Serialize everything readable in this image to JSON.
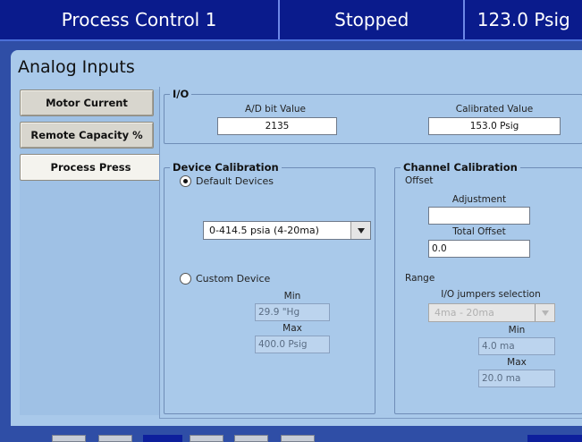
{
  "header": {
    "title": "Process Control 1",
    "status": "Stopped",
    "pressure": "123.0 Psig"
  },
  "panel": {
    "title": "Analog Inputs"
  },
  "tabs": [
    {
      "label": "Motor Current",
      "active": false
    },
    {
      "label": "Remote Capacity %",
      "active": false
    },
    {
      "label": "Process Press",
      "active": true
    }
  ],
  "io": {
    "legend": "I/O",
    "ad_bit_label": "A/D bit Value",
    "ad_bit_value": "2135",
    "calibrated_label": "Calibrated Value",
    "calibrated_value": "153.0 Psig"
  },
  "device_calibration": {
    "legend": "Device Calibration",
    "default_label": "Default Devices",
    "default_selected": true,
    "device_select_value": "0-414.5 psia (4-20ma)",
    "custom_label": "Custom Device",
    "min_label": "Min",
    "min_value": "29.9 \"Hg",
    "max_label": "Max",
    "max_value": "400.0 Psig"
  },
  "channel_calibration": {
    "legend": "Channel Calibration",
    "offset_label": "Offset",
    "adjustment_label": "Adjustment",
    "adjustment_value": "",
    "total_offset_label": "Total Offset",
    "total_offset_value": "0.0",
    "range_label": "Range",
    "jumpers_label": "I/O jumpers selection",
    "jumpers_value": "4ma - 20ma",
    "min_label": "Min",
    "min_value": "4.0 ma",
    "max_label": "Max",
    "max_value": "20.0 ma"
  },
  "colors": {
    "header_bg": "#0a1b8c",
    "panel_bg": "#a9c9ea",
    "frame_bg": "#2f4ea6"
  }
}
